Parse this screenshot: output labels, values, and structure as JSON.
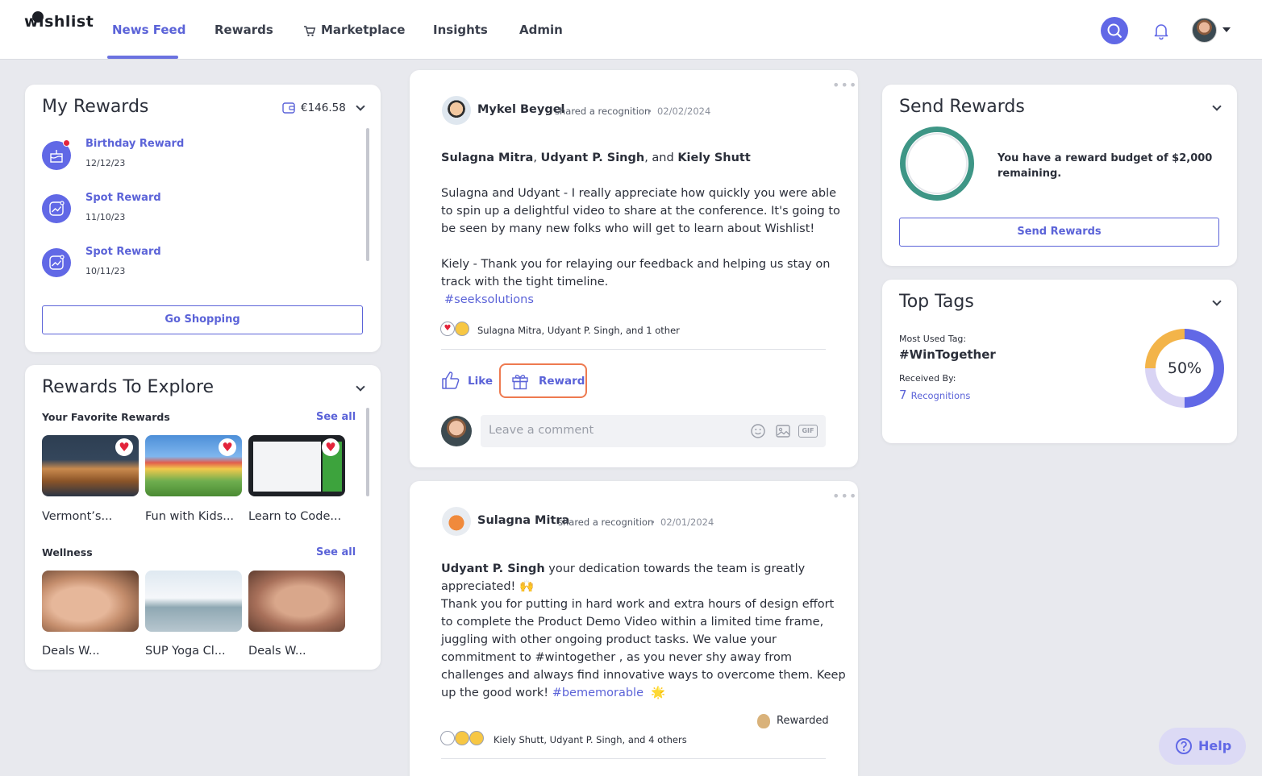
{
  "app": {
    "logo": "wishlist"
  },
  "nav": {
    "items": [
      {
        "label": "News Feed"
      },
      {
        "label": "Rewards"
      },
      {
        "label": "Marketplace"
      },
      {
        "label": "Insights"
      },
      {
        "label": "Admin"
      }
    ],
    "active": "News Feed"
  },
  "my_rewards": {
    "title": "My Rewards",
    "balance": "€146.58",
    "items": [
      {
        "name": "Birthday Reward",
        "date": "12/12/23"
      },
      {
        "name": "Spot Reward",
        "date": "11/10/23"
      },
      {
        "name": "Spot Reward",
        "date": "10/11/23"
      }
    ],
    "button": "Go Shopping"
  },
  "explore": {
    "title": "Rewards To Explore",
    "favorites_label": "Your Favorite Rewards",
    "see_all": "See all",
    "favorites": [
      {
        "label": "Vermont’s..."
      },
      {
        "label": "Fun with Kids..."
      },
      {
        "label": "Learn to Code..."
      }
    ],
    "wellness_label": "Wellness",
    "wellness": [
      {
        "label": "Deals W..."
      },
      {
        "label": "SUP Yoga Cl..."
      },
      {
        "label": "Deals W..."
      }
    ]
  },
  "post1": {
    "author": "Mykel Beygel",
    "action": "shared a recognition",
    "date": "02/02/2024",
    "recipients": {
      "r1": "Sulagna Mitra",
      "r2": "Udyant P. Singh",
      "r3": "Kiely Shutt",
      "sep1": ", ",
      "sep2": ", and "
    },
    "line1": "Sulagna and Udyant - I really appreciate how quickly you were able",
    "line2": "to spin up a delightful video to share at the conference. It's going to",
    "line3": "be seen by many new folks who will get to learn about Wishlist!",
    "line4": "Kiely - Thank you for relaying our feedback and helping us stay on",
    "line5": "track with the tight timeline.",
    "hashtag": "#seeksolutions",
    "reactors": "Sulagna Mitra, Udyant P. Singh, and 1 other",
    "like": "Like",
    "reward": "Reward",
    "comment_placeholder": "Leave a comment",
    "gif": "GIF"
  },
  "post2": {
    "author": "Sulagna Mitra",
    "action": "shared a recognition",
    "date": "02/01/2024",
    "mention": "Udyant P. Singh",
    "line1": " your dedication towards the team is greatly",
    "line2": "appreciated! 🙌",
    "line3": " Thank you for putting in hard work and extra hours of design effort",
    "line4": "to complete the Product Demo Video within a limited time frame,",
    "line5": "juggling with other ongoing product tasks. We value your",
    "line6": "commitment to #wintogether , as you never shy away from",
    "line7": "challenges and always find innovative ways to overcome them. Keep",
    "line8a": "up the good work! ",
    "hashtag": "#bememorable",
    "line8b": "🌟",
    "rewarded": "Rewarded",
    "reactors": "Kiely Shutt, Udyant P. Singh, and 4 others"
  },
  "send_rewards": {
    "title": "Send Rewards",
    "budget_line1": "You have a reward budget of $2,000",
    "budget_line2": "remaining.",
    "button": "Send Rewards"
  },
  "top_tags": {
    "title": "Top Tags",
    "most_used_label": "Most Used Tag:",
    "tag": "#WinTogether",
    "received_label": "Received By:",
    "count": "7",
    "count_unit": "Recognitions",
    "percent_label": "50%",
    "donut_colors": {
      "primary": "#6168e6",
      "secondary": "#d9d4f4",
      "accent": "#f3b449"
    }
  },
  "help": {
    "label": "Help"
  },
  "colors": {
    "accent": "#5b63d8",
    "highlight": "#ee7a50",
    "ring": "#3e9686"
  }
}
